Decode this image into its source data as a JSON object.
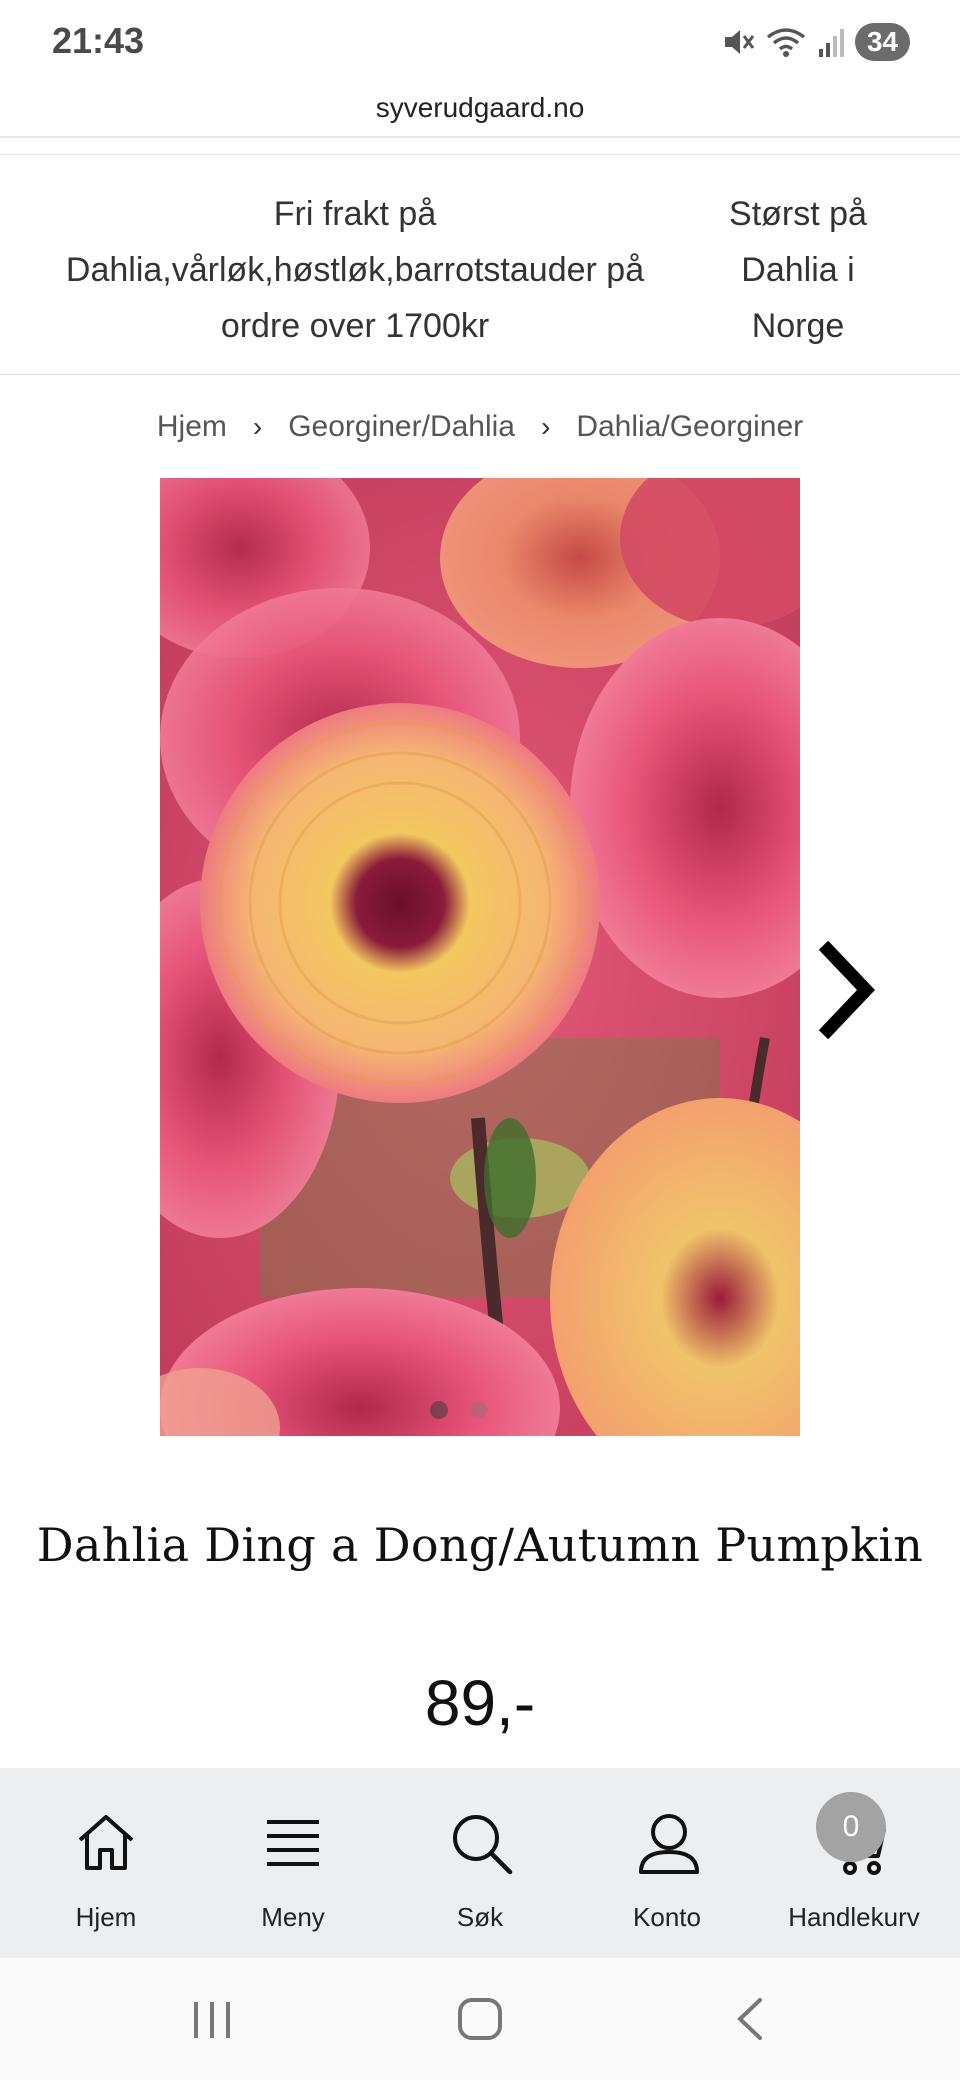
{
  "status_bar": {
    "time": "21:43",
    "battery": "34",
    "icons": [
      "mute-icon",
      "wifi-icon",
      "signal-icon"
    ]
  },
  "browser": {
    "url": "syverudgaard.no"
  },
  "promo": {
    "left_lines": [
      "Fri frakt på",
      "Dahlia,vårløk,høstløk,barrotstauder på",
      "ordre over 1700kr"
    ],
    "right_lines": [
      "Størst på",
      "Dahlia i",
      "Norge"
    ]
  },
  "breadcrumb": {
    "items": [
      "Hjem",
      "Georginer/Dahlia",
      "Dahlia/Georginer"
    ],
    "separator": "›"
  },
  "product": {
    "image_alt": "",
    "title": "Dahlia Ding a Dong/Autumn Pumpkin",
    "price": "89,-",
    "gallery_dots": 2
  },
  "bottom_nav": {
    "items": [
      {
        "label": "Hjem",
        "icon": "home-icon"
      },
      {
        "label": "Meny",
        "icon": "menu-icon"
      },
      {
        "label": "Søk",
        "icon": "search-icon"
      },
      {
        "label": "Konto",
        "icon": "user-icon"
      },
      {
        "label": "Handlekurv",
        "icon": "cart-icon"
      }
    ],
    "cart_count": "0"
  },
  "colors": {
    "nav_background": "#eceef0",
    "badge": "#a3a3a3"
  }
}
